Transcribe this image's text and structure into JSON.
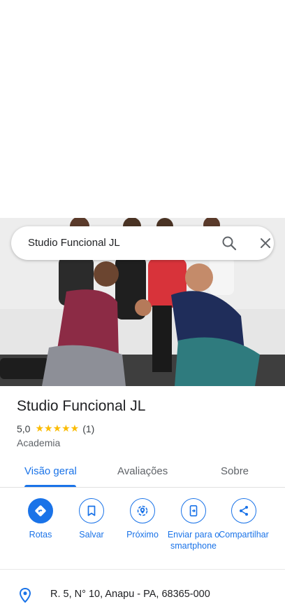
{
  "search": {
    "query": "Studio Funcional JL"
  },
  "place": {
    "name": "Studio Funcional JL",
    "rating": "5,0",
    "stars": "★★★★★",
    "review_count": "(1)",
    "category": "Academia",
    "address": "R. 5, N° 10, Anapu - PA, 68365-000"
  },
  "tabs": [
    {
      "label": "Visão geral",
      "active": true
    },
    {
      "label": "Avaliações",
      "active": false
    },
    {
      "label": "Sobre",
      "active": false
    }
  ],
  "actions": [
    {
      "label": "Rotas",
      "icon": "directions-icon"
    },
    {
      "label": "Salvar",
      "icon": "bookmark-icon"
    },
    {
      "label": "Próximo",
      "icon": "nearby-icon"
    },
    {
      "label": "Enviar para o smartphone",
      "icon": "send-to-phone-icon"
    },
    {
      "label": "Compartilhar",
      "icon": "share-icon"
    }
  ],
  "colors": {
    "accent": "#1a73e8",
    "star": "#fbbc04"
  }
}
